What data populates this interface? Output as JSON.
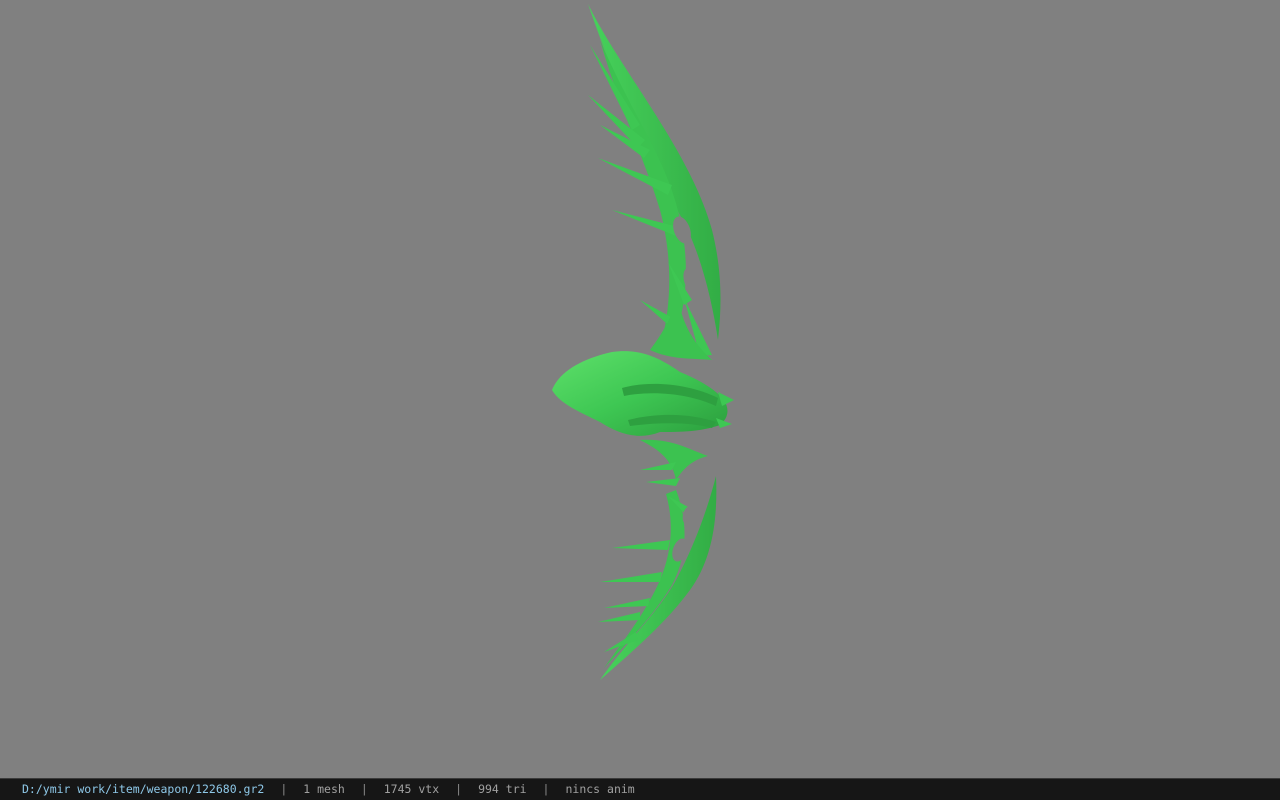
{
  "viewport": {
    "background_color": "#808080",
    "model_color": "#3ec753",
    "model_shade_color": "#2ea040",
    "model_highlight_color": "#5ee06a"
  },
  "statusbar": {
    "file_path": "D:/ymir work/item/weapon/122680.gr2",
    "separator": "|",
    "mesh_count": "1 mesh",
    "vertex_count": "1745 vtx",
    "triangle_count": "994 tri",
    "animation": "nincs anim"
  }
}
